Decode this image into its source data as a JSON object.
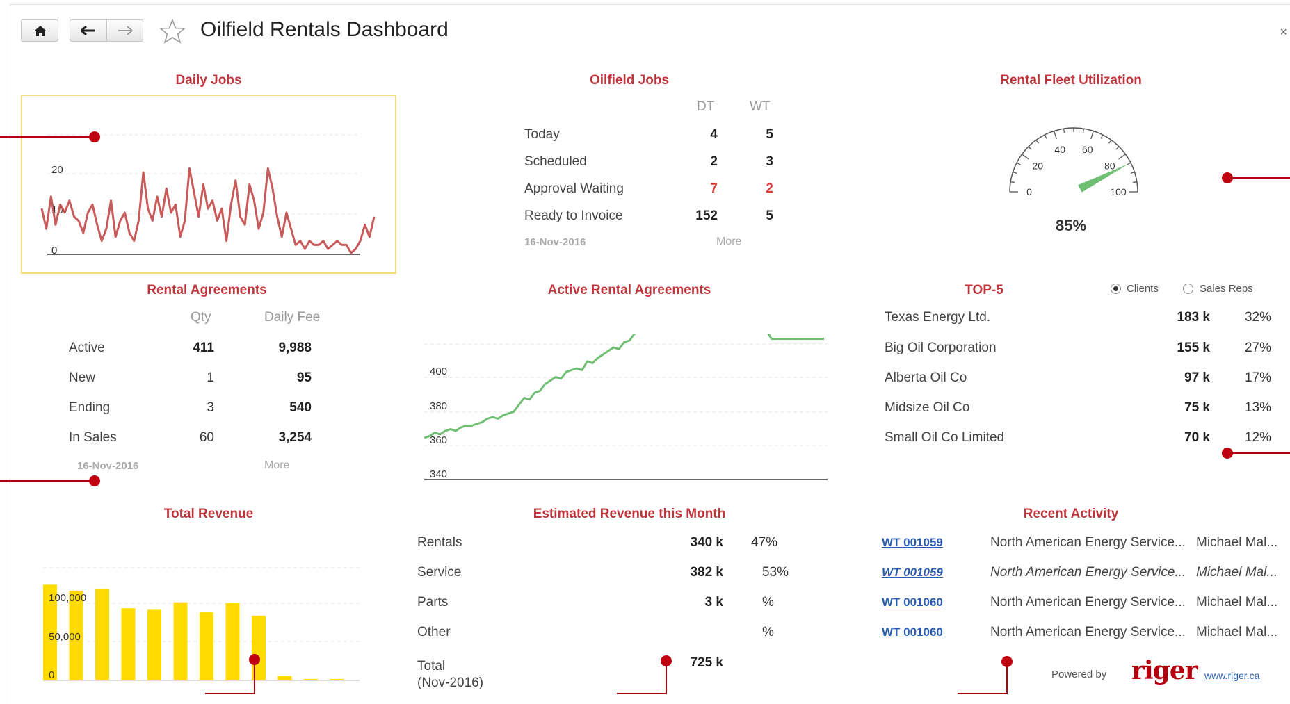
{
  "header": {
    "title": "Oilfield Rentals Dashboard",
    "close": "×"
  },
  "colors": {
    "accent": "#c0343c",
    "line_red": "#c85a5a",
    "line_green": "#6fbf73",
    "bar_yellow": "#ffdb00",
    "alert": "#e03a3a"
  },
  "daily_jobs": {
    "title": "Daily Jobs",
    "chart_data": {
      "type": "line",
      "y_ticks": [
        "20",
        "10",
        "0"
      ],
      "values": [
        11,
        6,
        14,
        7,
        12,
        10,
        13,
        9,
        8,
        5,
        10,
        12,
        7,
        3,
        6,
        13,
        4,
        8,
        10,
        5,
        3,
        8,
        20,
        11,
        8,
        14,
        9,
        16,
        10,
        12,
        4,
        8,
        21,
        15,
        9,
        17,
        11,
        13,
        8,
        11,
        3,
        12,
        18,
        9,
        7,
        17,
        13,
        6,
        10,
        21,
        16,
        9,
        4,
        10,
        6,
        2,
        3,
        1,
        3,
        2,
        2,
        3,
        1,
        2,
        3,
        2,
        2,
        0,
        1,
        3,
        7,
        4,
        9
      ]
    }
  },
  "oilfield_jobs": {
    "title": "Oilfield Jobs",
    "columns": [
      "DT",
      "WT"
    ],
    "rows": [
      {
        "label": "Today",
        "dt": "4",
        "wt": "5"
      },
      {
        "label": "Scheduled",
        "dt": "2",
        "wt": "3"
      },
      {
        "label": "Approval Waiting",
        "dt": "7",
        "wt": "2"
      },
      {
        "label": "Ready to Invoice",
        "dt": "152",
        "wt": "5"
      }
    ],
    "date": "16-Nov-2016",
    "more": "More"
  },
  "fleet": {
    "title": "Rental Fleet Utilization",
    "gauge_value": 85,
    "gauge_labels": [
      "0",
      "20",
      "40",
      "60",
      "80",
      "100"
    ],
    "value_label": "85%"
  },
  "rental_agreements": {
    "title": "Rental Agreements",
    "columns": [
      "Qty",
      "Daily Fee"
    ],
    "rows": [
      {
        "label": "Active",
        "qty": "411",
        "fee": "9,988"
      },
      {
        "label": "New",
        "qty": "1",
        "fee": "95"
      },
      {
        "label": "Ending",
        "qty": "3",
        "fee": "540"
      },
      {
        "label": "In Sales",
        "qty": "60",
        "fee": "3,254"
      }
    ],
    "date": "16-Nov-2016",
    "more": "More"
  },
  "active_agreements": {
    "title": "Active Rental Agreements",
    "chart_data": {
      "type": "line",
      "y_ticks": [
        "400",
        "380",
        "360",
        "340"
      ],
      "ylim": [
        335,
        425
      ],
      "values": [
        359,
        360,
        362,
        361,
        363,
        364,
        363,
        365,
        366,
        366,
        367,
        368,
        370,
        371,
        370,
        372,
        373,
        374,
        378,
        382,
        381,
        385,
        386,
        390,
        392,
        394,
        393,
        397,
        398,
        399,
        398,
        403,
        402,
        405,
        407,
        409,
        411,
        410,
        414,
        415,
        419,
        421,
        421,
        421,
        421,
        421,
        421,
        421,
        421,
        421,
        421,
        421,
        421,
        421,
        421,
        421,
        421,
        421,
        421,
        421,
        421,
        421,
        421,
        421,
        421,
        421,
        416,
        416,
        416,
        416,
        416,
        416,
        416,
        416,
        416,
        416,
        416
      ]
    }
  },
  "top5": {
    "title": "TOP-5",
    "options": [
      "Clients",
      "Sales Reps"
    ],
    "rows": [
      {
        "name": "Texas Energy Ltd.",
        "value": "183 k",
        "pct": "32%"
      },
      {
        "name": "Big Oil Corporation",
        "value": "155 k",
        "pct": "27%"
      },
      {
        "name": "Alberta Oil Co",
        "value": "97 k",
        "pct": "17%"
      },
      {
        "name": "Midsize Oil Co",
        "value": "75 k",
        "pct": "13%"
      },
      {
        "name": "Small Oil Co Limited",
        "value": "70 k",
        "pct": "12%"
      }
    ]
  },
  "total_revenue": {
    "title": "Total Revenue",
    "chart_data": {
      "type": "bar",
      "y_ticks": [
        "100,000",
        "50,000",
        "0"
      ],
      "ylim": [
        0,
        170000
      ],
      "values": [
        130000,
        122000,
        124000,
        98000,
        96000,
        106000,
        93000,
        105000,
        88000,
        6000,
        2000,
        2000
      ]
    }
  },
  "estimated_revenue": {
    "title": "Estimated Revenue this Month",
    "rows": [
      {
        "label": "Rentals",
        "value": "340 k",
        "pct": "47%"
      },
      {
        "label": "Service",
        "value": "382 k",
        "pct": "53%"
      },
      {
        "label": "Parts",
        "value": "3 k",
        "pct": "%"
      },
      {
        "label": "Other",
        "value": "",
        "pct": "%"
      }
    ],
    "total_label": "Total",
    "total_period": "(Nov-2016)",
    "total_value": "725 k"
  },
  "recent_activity": {
    "title": "Recent Activity",
    "rows": [
      {
        "id": "WT 001059",
        "company": "North American Energy Service...",
        "person": "Michael Mal..."
      },
      {
        "id": "WT 001059",
        "company": "North American Energy Service...",
        "person": "Michael Mal..."
      },
      {
        "id": "WT 001060",
        "company": "North American Energy Service...",
        "person": "Michael Mal..."
      },
      {
        "id": "WT 001060",
        "company": "North American Energy Service...",
        "person": "Michael Mal..."
      }
    ],
    "powered_by": "Powered by",
    "logo": "riger",
    "url": "www.riger.ca"
  }
}
